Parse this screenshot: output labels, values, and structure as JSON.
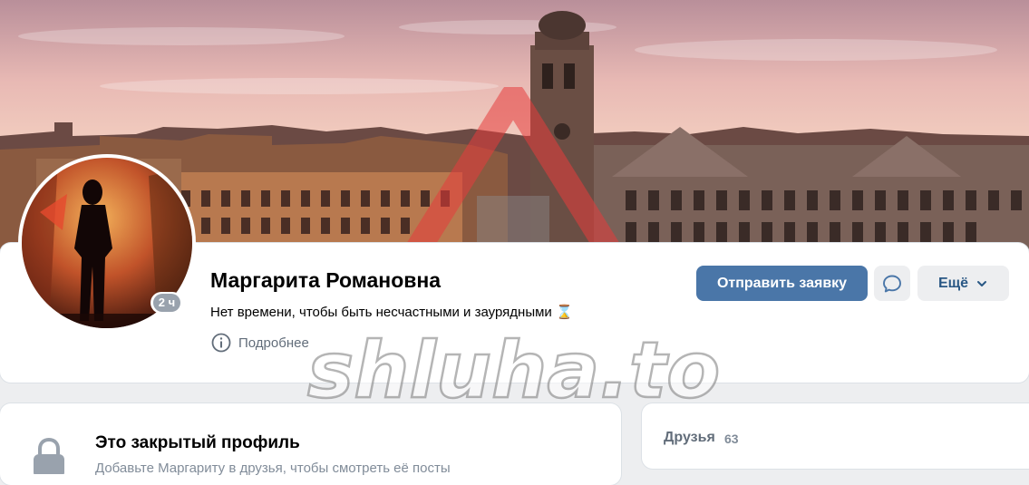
{
  "profile": {
    "name": "Маргарита Романовна",
    "status": "Нет времени, чтобы быть несчастными и заурядными",
    "status_emoji": "⌛",
    "online_badge": "2 ч",
    "more_info_label": "Подробнее"
  },
  "actions": {
    "send_request_label": "Отправить заявку",
    "more_label": "Ещё"
  },
  "closed_profile": {
    "title": "Это закрытый профиль",
    "text": "Добавьте Маргариту в друзья, чтобы смотреть её посты"
  },
  "friends": {
    "label": "Друзья",
    "count": "63"
  },
  "watermark": {
    "text": "shluha.to"
  },
  "colors": {
    "primary_button": "#4a76a8",
    "secondary_button": "#edeef0",
    "link": "#2a5885",
    "muted": "#818c99"
  },
  "icons": {
    "status_emoji": "hourglass-icon",
    "more_info": "info-icon",
    "message": "message-icon",
    "more_chevron": "chevron-down-icon",
    "closed_profile": "lock-icon"
  }
}
